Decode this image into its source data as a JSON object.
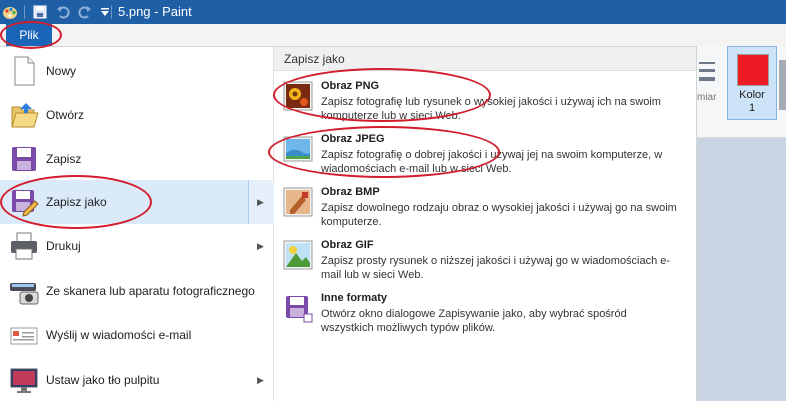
{
  "titlebar": {
    "title": "5.png - Paint"
  },
  "tabs": {
    "file_label": "Plik"
  },
  "ribbon": {
    "size_label": "miar",
    "color_label_line1": "Kolor",
    "color_label_line2": "1",
    "color1_value": "#ed1c24"
  },
  "menu": {
    "left_items": [
      {
        "label": "Nowy",
        "icon": "new-document-icon",
        "submenu": false
      },
      {
        "label": "Otwórz",
        "icon": "open-folder-icon",
        "submenu": false
      },
      {
        "label": "Zapisz",
        "icon": "save-disk-icon",
        "submenu": false
      },
      {
        "label": "Zapisz jako",
        "icon": "save-as-icon",
        "submenu": true,
        "selected": true
      },
      {
        "label": "Drukuj",
        "icon": "printer-icon",
        "submenu": true
      },
      {
        "label": "Ze skanera lub aparatu fotograficznego",
        "icon": "scanner-camera-icon",
        "submenu": false
      },
      {
        "label": "Wyślij w wiadomości e-mail",
        "icon": "email-icon",
        "submenu": false
      },
      {
        "label": "Ustaw jako tło pulpitu",
        "icon": "desktop-background-icon",
        "submenu": true
      }
    ],
    "right_header": "Zapisz jako",
    "formats": [
      {
        "name": "Obraz PNG",
        "desc": "Zapisz fotografię lub rysunek o wysokiej jakości i używaj ich na swoim komputerze lub w sieci Web.",
        "icon": "png-image-icon"
      },
      {
        "name": "Obraz JPEG",
        "desc": "Zapisz fotografię o dobrej jakości i używaj jej na swoim komputerze, w wiadomościach e-mail lub w sieci Web.",
        "icon": "jpeg-image-icon"
      },
      {
        "name": "Obraz BMP",
        "desc": "Zapisz dowolnego rodzaju obraz o wysokiej jakości i używaj go na swoim komputerze.",
        "icon": "bmp-image-icon"
      },
      {
        "name": "Obraz GIF",
        "desc": "Zapisz prosty rysunek o niższej jakości i używaj go w wiadomościach e-mail lub w sieci Web.",
        "icon": "gif-image-icon"
      },
      {
        "name": "Inne formaty",
        "desc": "Otwórz okno dialogowe Zapisywanie jako, aby wybrać spośród wszystkich możliwych typów plików.",
        "icon": "other-formats-icon"
      }
    ]
  },
  "colors": {
    "titlebar": "#1e5fa6",
    "file_tab": "#1a65b8",
    "selection": "#dbeaf8",
    "annotation": "#d21e2c"
  }
}
